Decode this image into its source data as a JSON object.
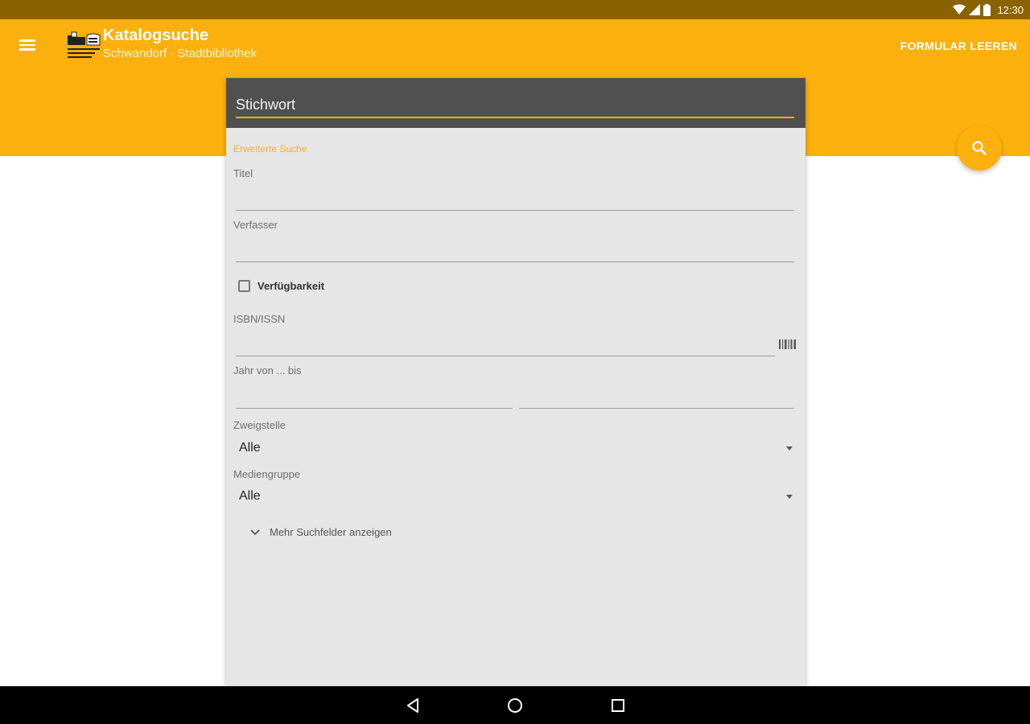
{
  "status_bar": {
    "time": "12:30"
  },
  "app_bar": {
    "title": "Katalogsuche",
    "subtitle": "Schwandorf · Stadtbibliothek",
    "clear_label": "FORMULAR LEEREN"
  },
  "search": {
    "keyword_placeholder": "Stichwort",
    "section_title": "Erweiterte Suche",
    "title_label": "Titel",
    "author_label": "Verfasser",
    "availability_label": "Verfügbarkeit",
    "isbn_label": "ISBN/ISSN",
    "year_label": "Jahr von ... bis",
    "branch_label": "Zweigstelle",
    "branch_value": "Alle",
    "media_label": "Mediengruppe",
    "media_value": "Alle",
    "more_fields_label": "Mehr Suchfelder anzeigen"
  },
  "colors": {
    "accent": "#fbb00e",
    "status_bar": "#8a6300",
    "keyword_bar": "#505050",
    "card_bg": "#e6e6e6"
  },
  "icons": [
    "menu-icon",
    "library-logo",
    "search-icon",
    "barcode-icon",
    "chevron-down-icon",
    "back-icon",
    "home-icon",
    "recents-icon",
    "wifi-icon",
    "signal-icon",
    "battery-icon"
  ]
}
